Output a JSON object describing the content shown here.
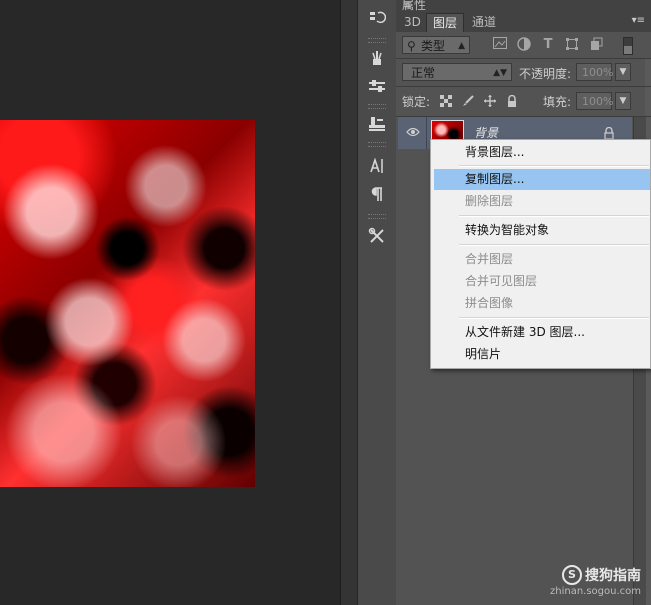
{
  "panel": {
    "title": "属性",
    "tabs": [
      {
        "label": "3D"
      },
      {
        "label": "图层"
      },
      {
        "label": "通道"
      }
    ],
    "filter": {
      "kind": "类型",
      "search_glyph": "⚲"
    },
    "blend": {
      "mode": "正常",
      "opacity_label": "不透明度:",
      "opacity_value": "100%"
    },
    "lock": {
      "label": "锁定:",
      "fill_label": "填充:",
      "fill_value": "100%"
    }
  },
  "layer": {
    "name": "背景"
  },
  "context_menu": {
    "items": [
      {
        "label": "背景图层...",
        "enabled": true
      },
      {
        "label": "复制图层...",
        "enabled": true,
        "highlighted": true
      },
      {
        "label": "删除图层",
        "enabled": false
      },
      {
        "label": "转换为智能对象",
        "enabled": true
      },
      {
        "label": "合并图层",
        "enabled": false
      },
      {
        "label": "合并可见图层",
        "enabled": false
      },
      {
        "label": "拼合图像",
        "enabled": false
      },
      {
        "label": "从文件新建 3D 图层...",
        "enabled": true
      },
      {
        "label": "明信片",
        "enabled": true
      }
    ]
  },
  "watermark": {
    "brand": "搜狗指南",
    "logo_letter": "S",
    "url": "zhinan.sogou.com"
  },
  "colors": {
    "highlight": "#97c4f0",
    "selected_layer": "#596374",
    "panel_bg": "#535353"
  }
}
